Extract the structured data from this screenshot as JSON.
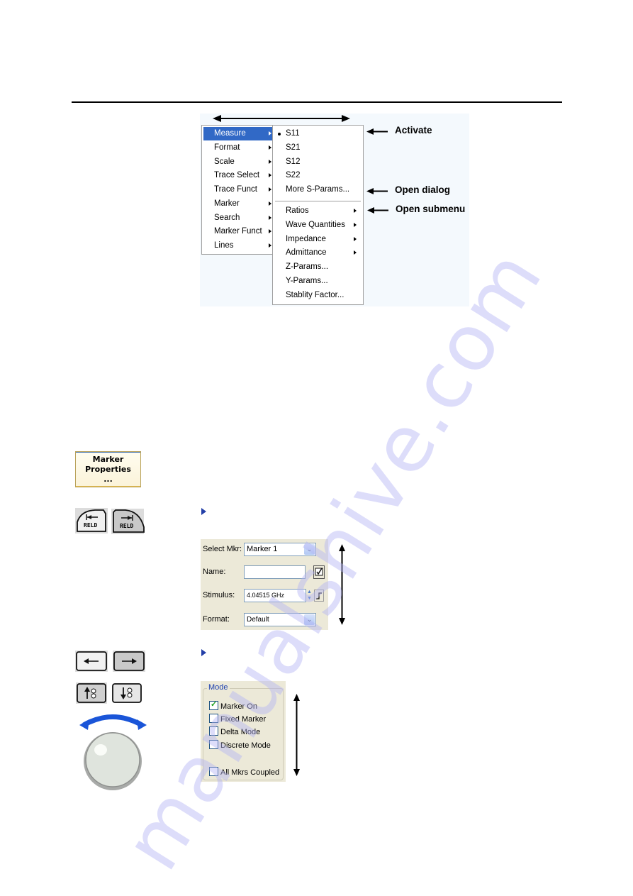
{
  "watermark": "manualshive.com",
  "figure_menu": {
    "main_menu": [
      {
        "label": "Measure",
        "submenu": true,
        "selected": true
      },
      {
        "label": "Format",
        "submenu": true
      },
      {
        "label": "Scale",
        "submenu": true
      },
      {
        "label": "Trace Select",
        "submenu": true
      },
      {
        "label": "Trace Funct",
        "submenu": true
      },
      {
        "label": "Marker",
        "submenu": true
      },
      {
        "label": "Search",
        "submenu": true
      },
      {
        "label": "Marker Funct",
        "submenu": true
      },
      {
        "label": "Lines",
        "submenu": true
      }
    ],
    "sub_menu": [
      {
        "label": "S11",
        "checked": true
      },
      {
        "label": "S21"
      },
      {
        "label": "S12"
      },
      {
        "label": "S22"
      },
      {
        "label": "More S-Params..."
      },
      {
        "label": "Ratios",
        "submenu": true
      },
      {
        "label": "Wave Quantities",
        "submenu": true
      },
      {
        "label": "Impedance",
        "submenu": true
      },
      {
        "label": "Admittance",
        "submenu": true
      },
      {
        "label": "Z-Params..."
      },
      {
        "label": "Y-Params..."
      },
      {
        "label": "Stablity Factor..."
      }
    ],
    "callouts": {
      "activate": "Activate",
      "open_dialog": "Open dialog",
      "open_submenu": "Open submenu"
    },
    "selection_color": "#3169c6"
  },
  "softkey": {
    "line1": "Marker",
    "line2": "Properties",
    "line3": "..."
  },
  "hardkeys": {
    "reld_left": "RELD",
    "reld_right": "RELD"
  },
  "dialog": {
    "select_mkr_label": "Select Mkr:",
    "select_mkr_value": "Marker 1",
    "name_label": "Name:",
    "name_value": "",
    "stimulus_label": "Stimulus:",
    "stimulus_value": "4.04515 GHz",
    "format_label": "Format:",
    "format_value": "Default"
  },
  "mode_group": {
    "title": "Mode",
    "options": [
      {
        "label": "Marker On",
        "checked": true
      },
      {
        "label": "Fixed Marker",
        "checked": false
      },
      {
        "label": "Delta Mode",
        "checked": false
      },
      {
        "label": "Discrete Mode",
        "checked": false
      },
      {
        "label": "All Mkrs Coupled",
        "checked": false
      }
    ]
  }
}
